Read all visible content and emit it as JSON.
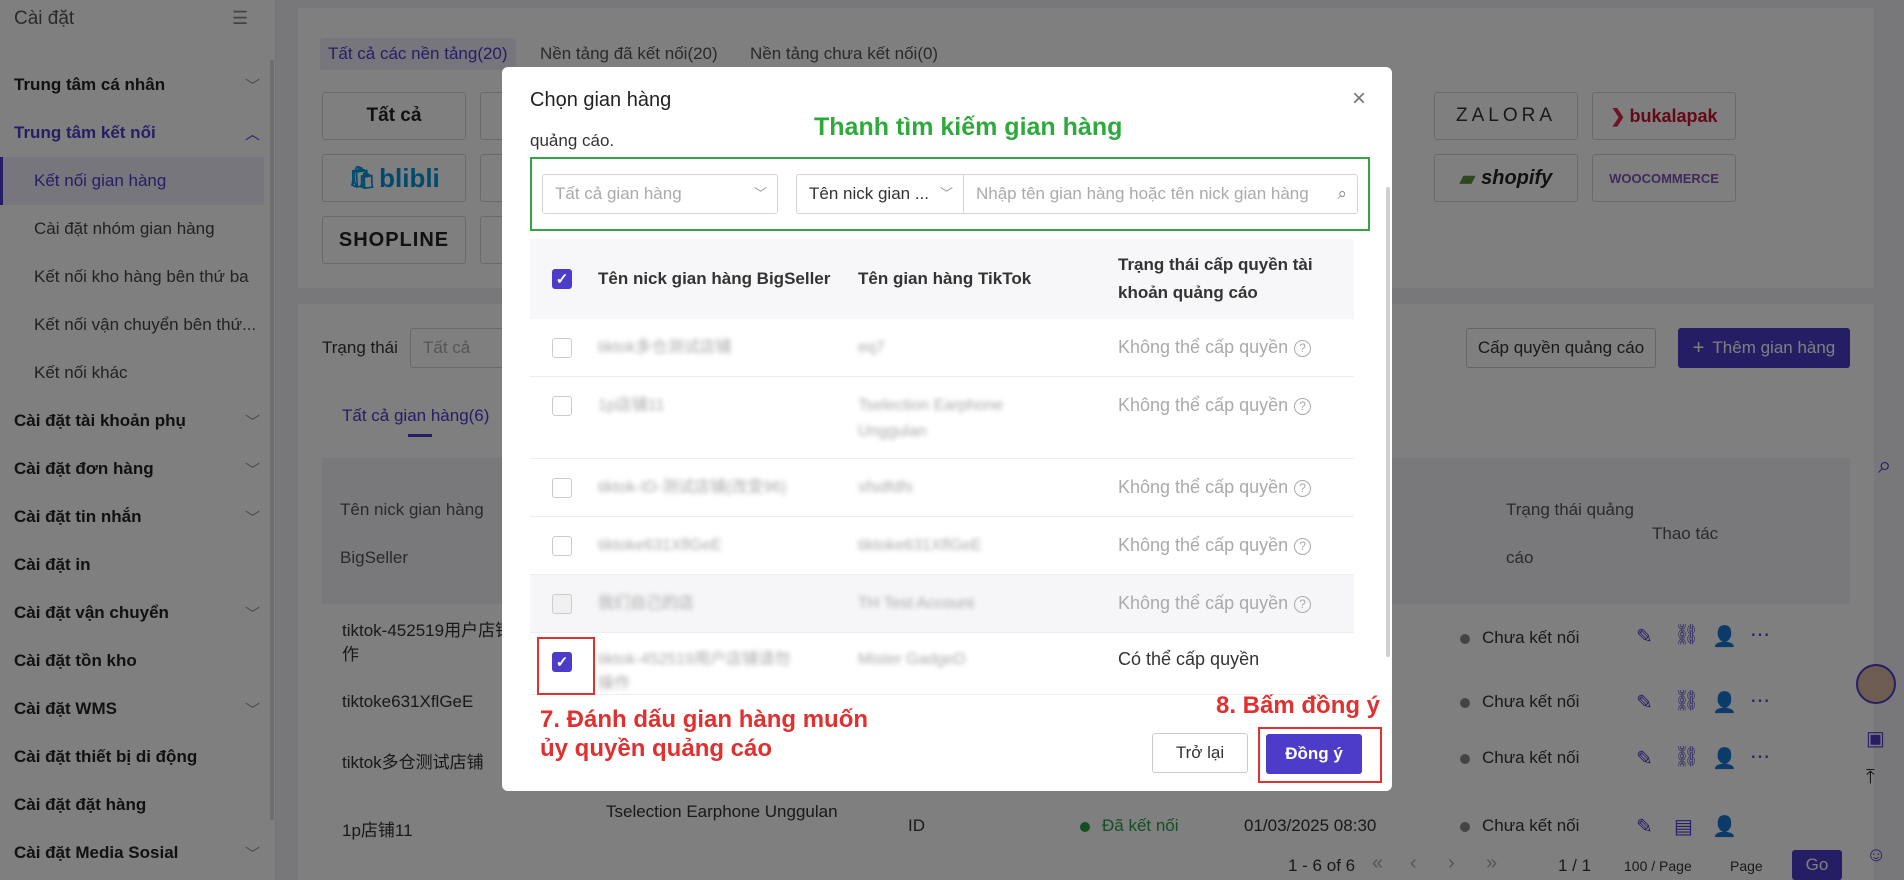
{
  "sidebar": {
    "title": "Cài đặt",
    "items": [
      {
        "label": "Trung tâm cá nhân"
      },
      {
        "label": "Trung tâm kết nối"
      },
      {
        "label": "Cài đặt tài khoản phụ"
      },
      {
        "label": "Cài đặt đơn hàng"
      },
      {
        "label": "Cài đặt tin nhắn"
      },
      {
        "label": "Cài đặt in"
      },
      {
        "label": "Cài đặt vận chuyển"
      },
      {
        "label": "Cài đặt tồn kho"
      },
      {
        "label": "Cài đặt WMS"
      },
      {
        "label": "Cài đặt thiết bị di động"
      },
      {
        "label": "Cài đặt đặt hàng"
      },
      {
        "label": "Cài đặt Media Sosial"
      }
    ],
    "subitems": [
      {
        "label": "Kết nối gian hàng"
      },
      {
        "label": "Cài đặt nhóm gian hàng"
      },
      {
        "label": "Kết nối kho hàng bên thứ ba"
      },
      {
        "label": "Kết nối vận chuyển bên thứ..."
      },
      {
        "label": "Kết nối khác"
      }
    ]
  },
  "platform_tabs": [
    {
      "label": "Tất cả các nền tảng(20)"
    },
    {
      "label": "Nền tảng đã kết nối(20)"
    },
    {
      "label": "Nền tảng chưa kết nối(0)"
    }
  ],
  "platforms": {
    "all": "Tất cả",
    "blibli": "blibli",
    "shopline": "SHOPLINE",
    "zalora": "ZALORA",
    "bukalapak": "bukalapak",
    "shopify": "shopify",
    "woocommerce": "WOOCOMMERCE"
  },
  "filters": {
    "status_label": "Trạng thái",
    "status_value": "Tất cả",
    "grant_ads_button": "Cấp quyền quảng cáo",
    "add_store_button": "Thêm gian hàng",
    "store_tab": "Tất cả gian hàng(6)"
  },
  "bg_table": {
    "col_nick": "Tên nick gian hàng",
    "col_nick2": "BigSeller",
    "col_ads_status": "Trạng thái quảng",
    "col_ads_status2": "cáo",
    "col_actions": "Thao tác",
    "rows": [
      {
        "nick": "tiktok-452519用户店铺",
        "nick2": "作",
        "status": "Chưa kết nối"
      },
      {
        "nick": "tiktoke631XflGeE",
        "status": "Chưa kết nối"
      },
      {
        "nick": "tiktok多仓测试店铺",
        "status": "Chưa kết nối"
      },
      {
        "nick": "1p店铺11",
        "shop": "Tselection Earphone Unggulan",
        "region": "ID",
        "conn": "Đã kết nối",
        "date": "01/03/2025 08:30",
        "status": "Chưa kết nối"
      }
    ]
  },
  "pagination": {
    "range": "1 - 6 of 6",
    "page": "1 / 1",
    "per_page": "100 / Page",
    "page_placeholder": "Page",
    "go": "Go"
  },
  "modal": {
    "title": "Chọn gian hàng",
    "fragment": "quảng cáo.",
    "annotation_search": "Thanh tìm kiếm gian hàng",
    "store_select": "Tất cả gian hàng",
    "field_select": "Tên nick gian ...",
    "search_placeholder": "Nhập tên gian hàng hoặc tên nick gian hàng",
    "col_nick": "Tên nick gian hàng BigSeller",
    "col_tiktok": "Tên gian hàng TikTok",
    "col_perm1": "Trạng thái cấp quyền tài",
    "col_perm2": "khoản quảng cáo",
    "rows": [
      {
        "nick": "tiktok多仓测试店铺",
        "shop": "eq7",
        "perm": "Không thể cấp quyền"
      },
      {
        "nick": "1p店铺11",
        "shop": "Tselection Earphone",
        "shop2": "Unggulan",
        "perm": "Không thể cấp quyền"
      },
      {
        "nick": "tiktok-ID-测试店铺(改变96)",
        "shop": "sfsdfdfs",
        "perm": "Không thể cấp quyền"
      },
      {
        "nick": "tiktoke631XflGeE",
        "shop": "tiktoke631XflGeE",
        "perm": "Không thể cấp quyền"
      },
      {
        "nick": "我们自己的店",
        "shop": "TH Test Account",
        "perm": "Không thể cấp quyền"
      },
      {
        "nick": "tiktok-452519用户店铺请勿",
        "nick2": "操作",
        "shop": "Mister GadgeD",
        "perm": "Có thể cấp quyền"
      }
    ],
    "annotation_step7_line1": "7. Đánh dấu gian hàng muốn",
    "annotation_step7_line2": "ủy quyền quảng cáo",
    "annotation_step8": "8. Bấm đồng ý",
    "back_button": "Trở lại",
    "agree_button": "Đồng ý"
  }
}
